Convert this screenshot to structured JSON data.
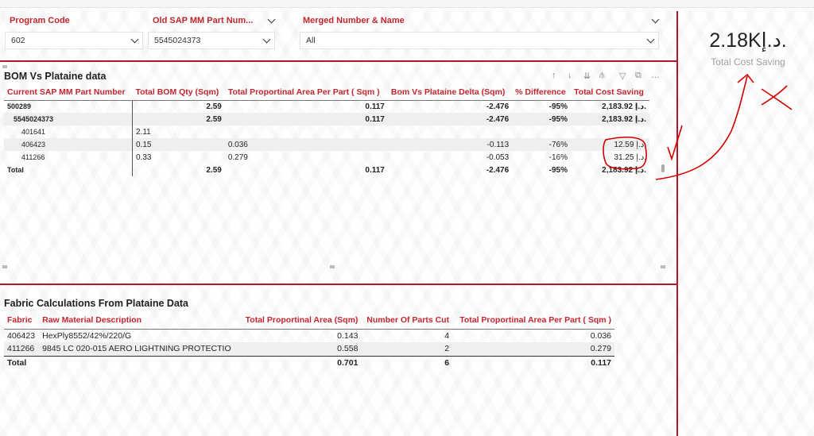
{
  "slicers": [
    {
      "title": "Program Code",
      "value": "602"
    },
    {
      "title": "Old SAP MM Part Num...",
      "value": "5545024373"
    },
    {
      "title": "Merged Number & Name",
      "value": "All"
    }
  ],
  "kpi": {
    "value": "2.18Kد.إ.",
    "label": "Total Cost Saving"
  },
  "bom_table": {
    "title": "BOM Vs Plataine data",
    "toolbar_icons": [
      "arrow-up-icon",
      "arrow-down-icon",
      "double-arrow-down-icon",
      "expand-hierarchy-icon",
      "filter-icon",
      "focus-mode-icon",
      "more-options-icon"
    ],
    "columns": [
      "Current SAP MM Part Number",
      "Total BOM Qty (Sqm)",
      "Total Proportinal Area Per Part ( Sqm )",
      "Bom Vs Plataine Delta (Sqm)",
      "% Difference",
      "Total Cost Saving"
    ],
    "rows": [
      {
        "cells": [
          "500289",
          "2.59",
          "0.117",
          "-2.476",
          "-95%",
          "2,183.92 د.إ."
        ]
      },
      {
        "cells": [
          "5545024373",
          "2.59",
          "0.117",
          "-2.476",
          "-95%",
          "2,183.92 د.إ."
        ]
      },
      {
        "cells": [
          "401641",
          "2.11",
          "",
          "",
          "",
          ""
        ]
      },
      {
        "cells": [
          "406423",
          "0.15",
          "0.036",
          "-0.113",
          "-76%",
          "12.59 د.إ."
        ]
      },
      {
        "cells": [
          "411266",
          "0.33",
          "0.279",
          "-0.053",
          "-16%",
          "31.25 د.إ."
        ]
      }
    ],
    "total": [
      "Total",
      "2.59",
      "0.117",
      "-2.476",
      "-95%",
      "2,183.92 د.إ."
    ]
  },
  "fabric_table": {
    "title": "Fabric Calculations From Plataine Data",
    "columns": [
      "Fabric",
      "Raw Material Description",
      "Total Proportinal Area (Sqm)",
      "Number Of Parts Cut",
      "Total Proportinal Area Per Part ( Sqm )"
    ],
    "rows": [
      {
        "cells": [
          "406423",
          "HexPly8552/42%/220/G",
          "0.143",
          "4",
          "0.036"
        ]
      },
      {
        "cells": [
          "411266",
          "9845 LC 020-015 AERO LIGHTNING PROTECTIO",
          "0.558",
          "2",
          "0.279"
        ]
      }
    ],
    "total": [
      "Total",
      "",
      "0.701",
      "6",
      "0.117"
    ]
  },
  "colors": {
    "accent": "#c4262e",
    "divider": "#b0172a",
    "annotation": "#d40000"
  }
}
